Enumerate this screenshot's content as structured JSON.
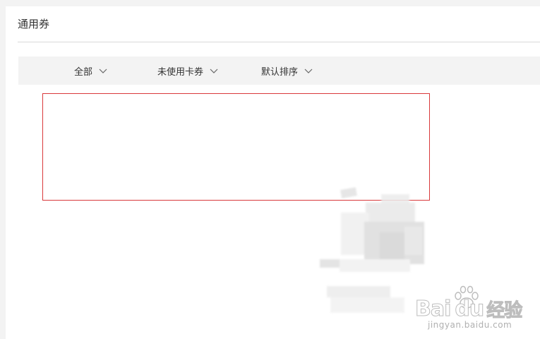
{
  "page": {
    "title": "通用券"
  },
  "filters": [
    {
      "label": "全部"
    },
    {
      "label": "未使用卡券"
    },
    {
      "label": "默认排序"
    }
  ],
  "watermark": {
    "brand_latin_1": "Bai",
    "brand_latin_2": "du",
    "brand_cn": "经验",
    "url": "jingyan.baidu.com"
  },
  "colors": {
    "highlight_border": "#d9393b",
    "filter_bar_bg": "#f3f3f3",
    "divider": "#d9d9d9"
  },
  "icons": {
    "filter_dropdown": "chevron-down-icon",
    "watermark_logo": "paw-icon"
  }
}
